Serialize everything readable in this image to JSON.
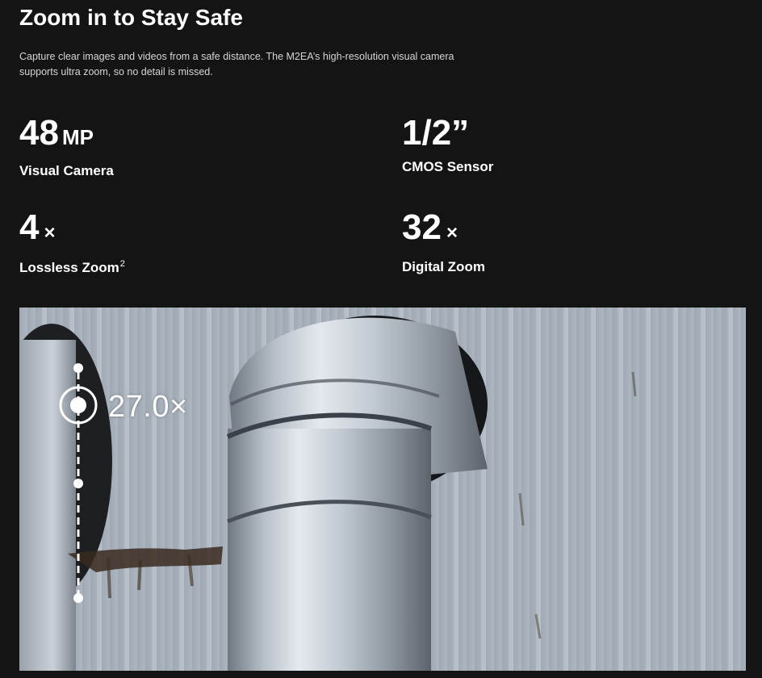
{
  "section": {
    "title": "Zoom in to Stay Safe",
    "description": "Capture clear images and videos from a safe distance. The M2EA’s high-resolution visual camera supports ultra zoom, so no detail is missed."
  },
  "stats": [
    {
      "value": "48",
      "unit": "MP",
      "label": "Visual Camera",
      "footnote": ""
    },
    {
      "value": "1/2”",
      "unit": "",
      "label": "CMOS Sensor",
      "footnote": ""
    },
    {
      "value": "4",
      "unit": "×",
      "label": "Lossless Zoom",
      "footnote": "2"
    },
    {
      "value": "32",
      "unit": "×",
      "label": "Digital Zoom",
      "footnote": ""
    }
  ],
  "zoom_overlay": {
    "readout": "27.0×",
    "slider_icon": "zoom-slider-icon"
  },
  "colors": {
    "background": "#141414",
    "text": "#ffffff",
    "muted_text": "#d6d6d6"
  }
}
